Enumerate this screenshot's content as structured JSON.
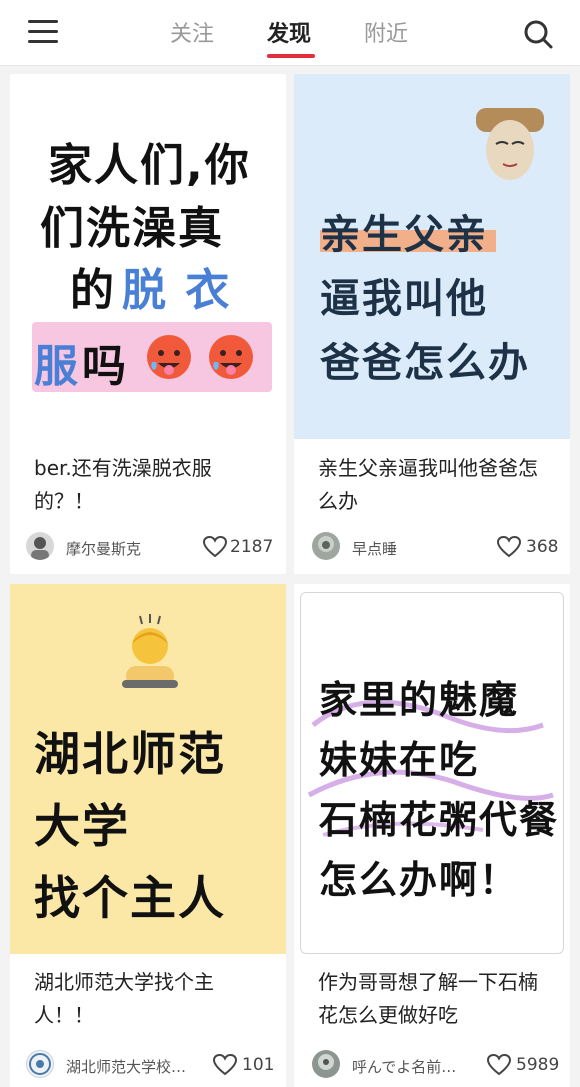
{
  "topbar": {
    "tabs": [
      "关注",
      "发现",
      "附近"
    ]
  },
  "feed": [
    {
      "cover_lines": [
        "家人们,你",
        "们洗澡真",
        "的",
        "脱 衣",
        "服",
        "吗"
      ],
      "caption": "ber.还有洗澡脱衣服的？！",
      "author": "摩尔曼斯克",
      "likes": "2187"
    },
    {
      "cover_lines": [
        "亲生父亲",
        "逼我叫他",
        "爸爸怎么办"
      ],
      "caption": "亲生父亲逼我叫他爸爸怎么办",
      "author": "早点睡",
      "likes": "368"
    },
    {
      "cover_lines": [
        "湖北师范",
        "大学",
        "找个主人"
      ],
      "caption": "湖北师范大学找个主人！！",
      "author": "湖北师范大学校…",
      "likes": "101"
    },
    {
      "cover_lines": [
        "家里的魅魔",
        "妹妹在吃",
        "石楠花粥代餐",
        "怎么办啊！"
      ],
      "caption": "作为哥哥想了解一下石楠花怎么更做好吃",
      "author": "呼んでよ名前…",
      "likes": "5989"
    }
  ],
  "colors": {
    "accent": "#e02e3b",
    "card1_bg": "#ffffff",
    "card2_bg": "#dcebfa",
    "card3_bg": "#fbe8a6",
    "card4_bg": "#ffffff",
    "blue_text": "#4a7fd6",
    "pink_highlight": "#f7c6e0",
    "purple_stroke": "#c58de0"
  },
  "icons": [
    "menu-icon",
    "search-icon",
    "heart-icon",
    "hot-face-emoji",
    "person-bowing-emoji"
  ]
}
